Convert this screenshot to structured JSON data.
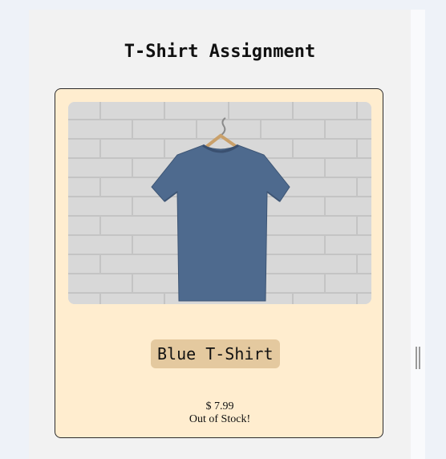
{
  "page": {
    "title": "T-Shirt Assignment"
  },
  "product": {
    "name": "Blue T-Shirt",
    "price": "$ 7.99",
    "stock_status": "Out of Stock!",
    "image_subject": "blue t-shirt on hanger against white brick wall",
    "colors": {
      "card_background": "#ffedcf",
      "name_tag_background": "#e4c99f",
      "shirt": "#4e6a8e"
    }
  }
}
